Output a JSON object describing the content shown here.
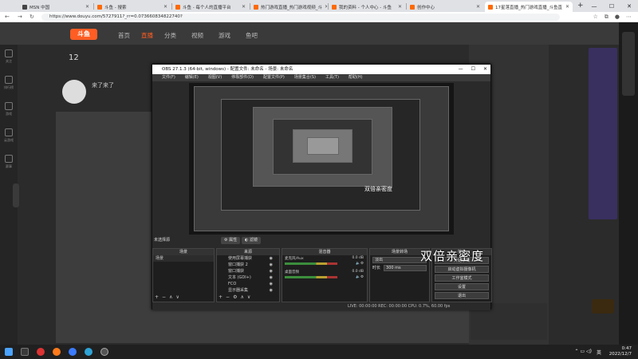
{
  "browser": {
    "tabs": [
      {
        "title": "MSN 中国"
      },
      {
        "title": "斗鱼 - 搜索"
      },
      {
        "title": "斗鱼 - 每个人的直播平台"
      },
      {
        "title": "热门游戏直播_热门游戏视频_斗"
      },
      {
        "title": "我的资料 - 个人中心 - 斗鱼"
      },
      {
        "title": "创作中心"
      },
      {
        "title": "17星落直播_热门游戏直播_斗鱼直"
      }
    ],
    "url": "https://www.douyu.com/5727911?_rr=0.073660834822740?"
  },
  "site": {
    "logo_text": "斗鱼",
    "nav": [
      "首页",
      "直播",
      "分类",
      "视频",
      "游戏",
      "鱼吧"
    ],
    "left_rail": [
      "关注",
      "排行榜",
      "游戏",
      "云游戏",
      "赛事"
    ],
    "viewer_count": "12",
    "streamer_name": "来了来了"
  },
  "obs": {
    "title": "OBS 27.1.3 (64-bit, windows) - 配置文件: 未命名 - 场景: 未命名",
    "menu": [
      "文件(F)",
      "编辑(E)",
      "视图(V)",
      "停靠部件(D)",
      "配置文件(P)",
      "场景集合(S)",
      "工具(T)",
      "帮助(H)"
    ],
    "no_source_selected": "未选择源",
    "props_button": "属性",
    "filters_button": "滤镜",
    "docks": {
      "scenes": {
        "title": "场景",
        "items": [
          "场景"
        ]
      },
      "sources": {
        "title": "来源",
        "items": [
          "使用屏幕捕获",
          "窗口捕获 2",
          "窗口捕获",
          "文本 (GDI+)",
          "FCO",
          "显示器采集"
        ]
      },
      "mixer": {
        "title": "混音器",
        "channels": [
          {
            "name": "麦克风/Aux",
            "level": "0.0 dB"
          },
          {
            "name": "桌面音频",
            "level": "0.0 dB"
          }
        ]
      },
      "transitions": {
        "title": "场景转场",
        "type": "淡出",
        "duration_label": "时长",
        "duration": "300 ms"
      },
      "controls": {
        "title": "控件",
        "buttons": [
          "开始录制",
          "启动虚拟摄像机",
          "工作室模式",
          "设置",
          "退出"
        ]
      }
    },
    "status": "LIVE: 00:00:00   REC: 00:00:00   CPU: 0.7%, 60.00 fps",
    "preview_overlay_text": "双倍亲密度"
  },
  "overlay_text": "双倍亲密度",
  "taskbar": {
    "time": "0:47",
    "date": "2022/12/7",
    "lang": "英"
  },
  "colors": {
    "accent": "#ff5d23",
    "obs_bg": "#2a2a2a",
    "page_bg": "#2b2b2b"
  }
}
